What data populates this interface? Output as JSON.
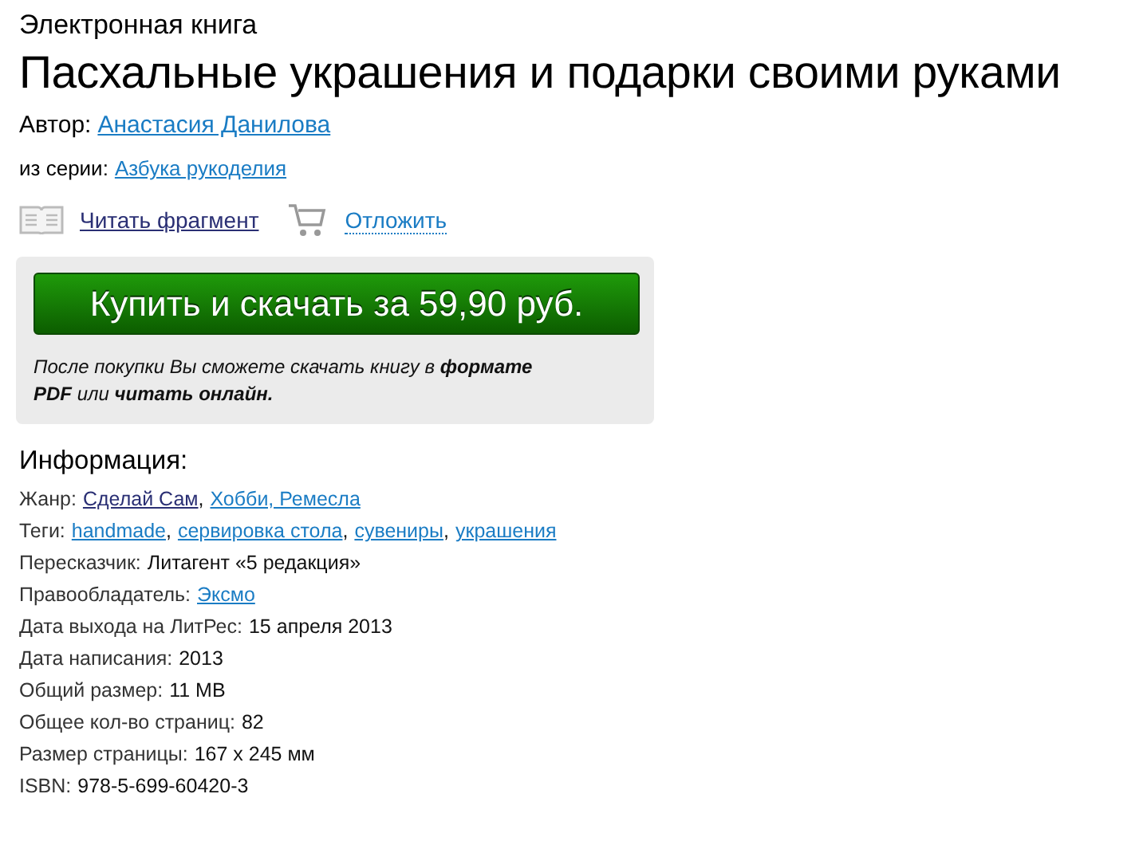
{
  "kind_label": "Электронная книга",
  "title": "Пасхальные украшения и подарки своими руками",
  "author": {
    "label": "Автор:",
    "name": "Анастасия Данилова"
  },
  "series": {
    "label": "из серии:",
    "name": "Азбука рукоделия"
  },
  "actions": [
    {
      "kind": "read",
      "label": "Читать фрагмент",
      "visited": true
    },
    {
      "kind": "cart",
      "label": "Отложить",
      "visited": false
    }
  ],
  "buy": {
    "button": "Купить и скачать за 59,90 руб.",
    "note": "После покупки Вы сможете скачать книгу в **формате PDF** или **читать онлайн.**"
  },
  "info": {
    "heading": "Информация:",
    "rows": [
      {
        "label": "Жанр:",
        "parts": [
          {
            "kind": "link",
            "text": "Сделай Сам",
            "visited": true
          },
          {
            "kind": "text",
            "text": ","
          },
          {
            "kind": "link",
            "text": "Хобби, Ремесла",
            "visited": false
          }
        ]
      },
      {
        "label": "Теги:",
        "parts": [
          {
            "kind": "link",
            "text": "handmade",
            "visited": false
          },
          {
            "kind": "text",
            "text": ","
          },
          {
            "kind": "link",
            "text": "сервировка стола",
            "visited": false
          },
          {
            "kind": "text",
            "text": ","
          },
          {
            "kind": "link",
            "text": "сувениры",
            "visited": false
          },
          {
            "kind": "text",
            "text": ","
          },
          {
            "kind": "link",
            "text": "украшения",
            "visited": false
          }
        ]
      },
      {
        "label": "Пересказчик:",
        "parts": [
          {
            "kind": "text",
            "text": "Литагент «5 редакция»"
          }
        ]
      },
      {
        "label": "Правообладатель:",
        "parts": [
          {
            "kind": "link",
            "text": "Эксмо",
            "visited": false
          }
        ]
      },
      {
        "label": "Дата выхода на ЛитРес:",
        "parts": [
          {
            "kind": "text",
            "text": "15 апреля 2013"
          }
        ]
      },
      {
        "label": "Дата написания:",
        "parts": [
          {
            "kind": "text",
            "text": "2013"
          }
        ]
      },
      {
        "label": "Общий размер:",
        "parts": [
          {
            "kind": "text",
            "text": "11 MB"
          }
        ]
      },
      {
        "label": "Общее кол-во страниц:",
        "parts": [
          {
            "kind": "text",
            "text": "82"
          }
        ]
      },
      {
        "label": "Размер страницы:",
        "parts": [
          {
            "kind": "text",
            "text": "167 x 245 мм"
          }
        ]
      },
      {
        "label": "ISBN:",
        "parts": [
          {
            "kind": "text",
            "text": "978-5-699-60420-3"
          }
        ]
      }
    ]
  }
}
